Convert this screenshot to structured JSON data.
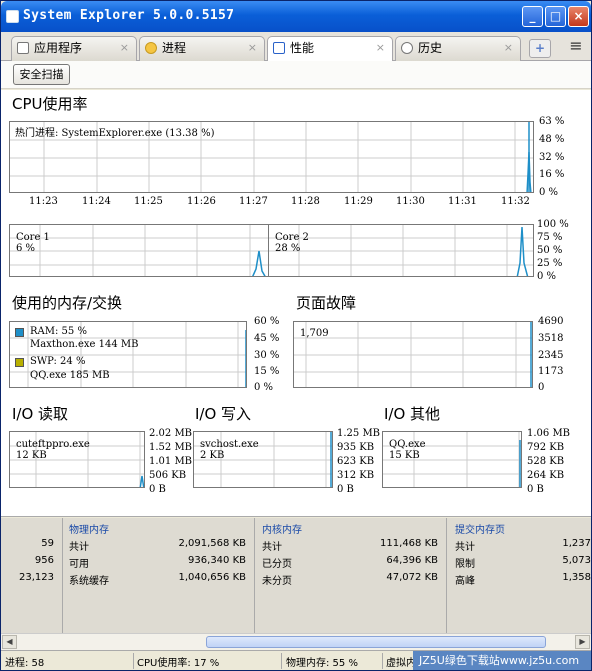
{
  "window": {
    "title": "System Explorer 5.0.0.5157",
    "minimize": "_",
    "maximize": "□",
    "close": "×"
  },
  "tabs": [
    {
      "label": "应用程序",
      "icon": "apps-icon",
      "close": "×"
    },
    {
      "label": "进程",
      "icon": "gear-icon",
      "close": "×"
    },
    {
      "label": "性能",
      "icon": "chart-icon",
      "close": "×",
      "active": true
    },
    {
      "label": "历史",
      "icon": "clock-icon",
      "close": "×"
    }
  ],
  "tab_add": "+",
  "menu_icon": "≡",
  "toolbar": {
    "scan_label": "安全扫描"
  },
  "cpu": {
    "title": "CPU使用率",
    "hot_process": "热门进程: SystemExplorer.exe (13.38 %)",
    "y_ticks": [
      "63 %",
      "48 %",
      "32 %",
      "16 %",
      "0 %"
    ],
    "x_ticks": [
      "11:23",
      "11:24",
      "11:25",
      "11:26",
      "11:27",
      "11:28",
      "11:29",
      "11:30",
      "11:31",
      "11:32"
    ],
    "core1_label": "Core 1",
    "core1_value": "6 %",
    "core2_label": "Core 2",
    "core2_value": "28 %",
    "core_ticks": [
      "100 %",
      "75 %",
      "50 %",
      "25 %",
      "0 %"
    ]
  },
  "memory": {
    "title": "使用的内存/交换",
    "ram": "RAM: 55 %",
    "ram_top": "Maxthon.exe 144 MB",
    "swp": "SWP: 24 %",
    "swp_top": "QQ.exe 185 MB",
    "ticks": [
      "60 %",
      "45 %",
      "30 %",
      "15 %",
      "0 %"
    ],
    "ram_color": "#1e8fc8",
    "swp_color": "#b8b000"
  },
  "pagefault": {
    "title": "页面故障",
    "value": "1,709",
    "ticks": [
      "4690",
      "3518",
      "2345",
      "1173",
      "0"
    ]
  },
  "io_read": {
    "title": "I/O 读取",
    "process": "cuteftppro.exe",
    "value": "12 KB",
    "ticks": [
      "2.02 MB",
      "1.52 MB",
      "1.01 MB",
      "506 KB",
      "0 B"
    ]
  },
  "io_write": {
    "title": "I/O 写入",
    "process": "svchost.exe",
    "value": "2 KB",
    "ticks": [
      "1.25 MB",
      "935 KB",
      "623 KB",
      "312 KB",
      "0 B"
    ]
  },
  "io_other": {
    "title": "I/O 其他",
    "process": "QQ.exe",
    "value": "15 KB",
    "ticks": [
      "1.06 MB",
      "792 KB",
      "528 KB",
      "264 KB",
      "0 B"
    ]
  },
  "bottom": {
    "col0": [
      "59",
      "956",
      "23,123"
    ],
    "phys": {
      "title": "物理内存",
      "rows": [
        [
          "共计",
          "2,091,568 KB"
        ],
        [
          "可用",
          "936,340 KB"
        ],
        [
          "系统缓存",
          "1,040,656 KB"
        ]
      ]
    },
    "kernel": {
      "title": "内核内存",
      "rows": [
        [
          "共计",
          "111,468 KB"
        ],
        [
          "已分页",
          "64,396 KB"
        ],
        [
          "未分页",
          "47,072 KB"
        ]
      ]
    },
    "commit": {
      "title": "提交内存页",
      "rows": [
        [
          "共计",
          "1,237"
        ],
        [
          "限制",
          "5,073"
        ],
        [
          "高峰",
          "1,358"
        ]
      ]
    }
  },
  "status": {
    "processes": "进程: 58",
    "cpu": "CPU使用率: 17 %",
    "phys": "物理内存: 55 %",
    "virt": "虚拟内存: 24 %"
  },
  "watermark": "JZ5U绿色下载站www.jz5u.com",
  "accent_color": "#1e8fc8"
}
